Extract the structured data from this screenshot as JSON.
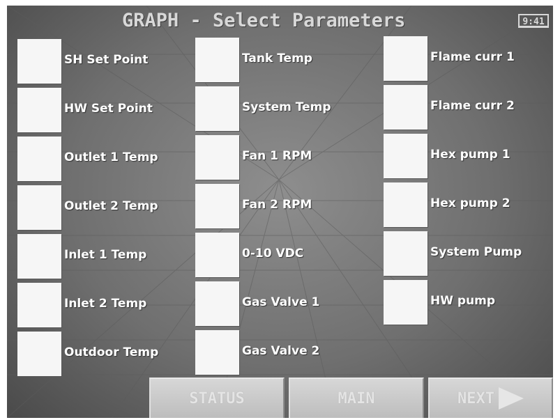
{
  "header": {
    "title": "GRAPH - Select Parameters",
    "clock": "9:41"
  },
  "columns": [
    {
      "items": [
        {
          "label": "SH Set Point"
        },
        {
          "label": "HW Set Point"
        },
        {
          "label": "Outlet 1 Temp"
        },
        {
          "label": "Outlet 2 Temp"
        },
        {
          "label": "Inlet 1 Temp"
        },
        {
          "label": "Inlet 2 Temp"
        },
        {
          "label": "Outdoor Temp"
        }
      ]
    },
    {
      "items": [
        {
          "label": "Tank Temp"
        },
        {
          "label": "System Temp"
        },
        {
          "label": "Fan 1 RPM"
        },
        {
          "label": "Fan 2 RPM"
        },
        {
          "label": "0-10 VDC"
        },
        {
          "label": "Gas Valve 1"
        },
        {
          "label": "Gas Valve 2"
        }
      ]
    },
    {
      "items": [
        {
          "label": "Flame curr 1"
        },
        {
          "label": "Flame curr 2"
        },
        {
          "label": "Hex pump 1"
        },
        {
          "label": "Hex pump 2"
        },
        {
          "label": "System Pump"
        },
        {
          "label": "HW pump"
        }
      ]
    }
  ],
  "footer": {
    "status_label": "STATUS",
    "main_label": "MAIN",
    "next_label": "NEXT"
  }
}
